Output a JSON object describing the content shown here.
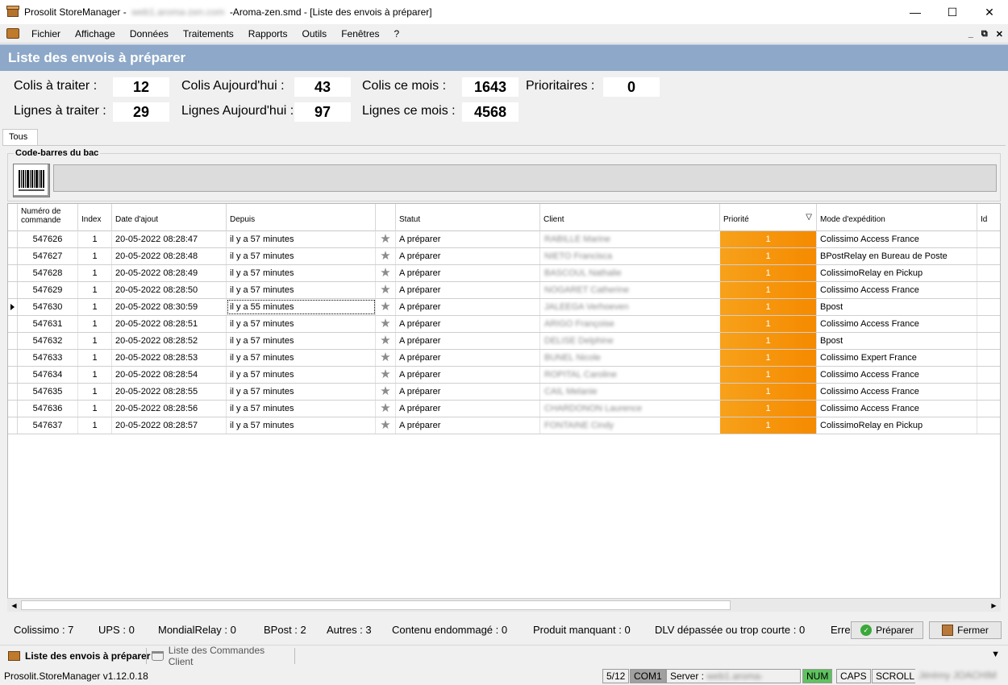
{
  "window": {
    "title_prefix": "Prosolit StoreManager -",
    "title_blurred": "web1.aroma-zen.com",
    "title_suffix": "-Aroma-zen.smd - [Liste des envois à préparer]",
    "minimize": "—",
    "maximize": "☐",
    "close": "✕"
  },
  "menu": {
    "items": [
      "Fichier",
      "Affichage",
      "Données",
      "Traitements",
      "Rapports",
      "Outils",
      "Fenêtres",
      "?"
    ],
    "mdi_min": "_",
    "mdi_restore": "⧉",
    "mdi_close": "✕"
  },
  "header": {
    "title": "Liste des envois à préparer"
  },
  "stats": {
    "colis_a_traiter_label": "Colis à traiter :",
    "colis_a_traiter": "12",
    "colis_aujourdhui_label": "Colis Aujourd'hui :",
    "colis_aujourdhui": "43",
    "colis_ce_mois_label": "Colis ce mois :",
    "colis_ce_mois": "1643",
    "prioritaires_label": "Prioritaires :",
    "prioritaires": "0",
    "lignes_a_traiter_label": "Lignes à traiter :",
    "lignes_a_traiter": "29",
    "lignes_aujourdhui_label": "Lignes Aujourd'hui :",
    "lignes_aujourdhui": "97",
    "lignes_ce_mois_label": "Lignes ce mois :",
    "lignes_ce_mois": "4568"
  },
  "tab": {
    "label": "Tous"
  },
  "barcode": {
    "group_title": "Code-barres du bac",
    "value": ""
  },
  "grid": {
    "headers": {
      "numero": "Numéro de commande",
      "index": "Index",
      "date": "Date d'ajout",
      "depuis": "Depuis",
      "statut": "Statut",
      "client": "Client",
      "priorite": "Priorité",
      "mode": "Mode d'expédition",
      "id": "Id"
    },
    "selected_row": 4,
    "rows": [
      {
        "numero": "547626",
        "index": "1",
        "date": "20-05-2022 08:28:47",
        "depuis": "il y a 57 minutes",
        "statut": "A préparer",
        "client": "RABILLE Marine",
        "priorite": "1",
        "mode": "Colissimo Access France"
      },
      {
        "numero": "547627",
        "index": "1",
        "date": "20-05-2022 08:28:48",
        "depuis": "il y a 57 minutes",
        "statut": "A préparer",
        "client": "NIETO Francisca",
        "priorite": "1",
        "mode": "BPostRelay en Bureau de Poste"
      },
      {
        "numero": "547628",
        "index": "1",
        "date": "20-05-2022 08:28:49",
        "depuis": "il y a 57 minutes",
        "statut": "A préparer",
        "client": "BASCOUL Nathalie",
        "priorite": "1",
        "mode": "ColissimoRelay en Pickup"
      },
      {
        "numero": "547629",
        "index": "1",
        "date": "20-05-2022 08:28:50",
        "depuis": "il y a 57 minutes",
        "statut": "A préparer",
        "client": "NOGARET Catherine",
        "priorite": "1",
        "mode": "Colissimo Access France"
      },
      {
        "numero": "547630",
        "index": "1",
        "date": "20-05-2022 08:30:59",
        "depuis": "il y a 55 minutes",
        "statut": "A préparer",
        "client": "JALEEGA Verhoeven",
        "priorite": "1",
        "mode": "Bpost"
      },
      {
        "numero": "547631",
        "index": "1",
        "date": "20-05-2022 08:28:51",
        "depuis": "il y a 57 minutes",
        "statut": "A préparer",
        "client": "ARIGO Françoise",
        "priorite": "1",
        "mode": "Colissimo Access France"
      },
      {
        "numero": "547632",
        "index": "1",
        "date": "20-05-2022 08:28:52",
        "depuis": "il y a 57 minutes",
        "statut": "A préparer",
        "client": "DELISE Delphine",
        "priorite": "1",
        "mode": "Bpost"
      },
      {
        "numero": "547633",
        "index": "1",
        "date": "20-05-2022 08:28:53",
        "depuis": "il y a 57 minutes",
        "statut": "A préparer",
        "client": "BUNEL Nicole",
        "priorite": "1",
        "mode": "Colissimo Expert France"
      },
      {
        "numero": "547634",
        "index": "1",
        "date": "20-05-2022 08:28:54",
        "depuis": "il y a 57 minutes",
        "statut": "A préparer",
        "client": "ROPITAL Caroline",
        "priorite": "1",
        "mode": "Colissimo Access France"
      },
      {
        "numero": "547635",
        "index": "1",
        "date": "20-05-2022 08:28:55",
        "depuis": "il y a 57 minutes",
        "statut": "A préparer",
        "client": "CAIL Melanie",
        "priorite": "1",
        "mode": "Colissimo Access France"
      },
      {
        "numero": "547636",
        "index": "1",
        "date": "20-05-2022 08:28:56",
        "depuis": "il y a 57 minutes",
        "statut": "A préparer",
        "client": "CHARDONON Laurence",
        "priorite": "1",
        "mode": "Colissimo Access France"
      },
      {
        "numero": "547637",
        "index": "1",
        "date": "20-05-2022 08:28:57",
        "depuis": "il y a 57 minutes",
        "statut": "A préparer",
        "client": "FONTAINE Cindy",
        "priorite": "1",
        "mode": "ColissimoRelay en Pickup"
      }
    ]
  },
  "bottom": {
    "colissimo": "Colissimo : 7",
    "ups": "UPS : 0",
    "mondialrelay": "MondialRelay : 0",
    "bpost": "BPost : 2",
    "autres": "Autres : 3",
    "contenu": "Contenu endommagé : 0",
    "produit": "Produit manquant : 0",
    "dlv": "DLV dépassée ou trop courte : 0",
    "erreur": "Erre",
    "preparer_btn": "Préparer",
    "fermer_btn": "Fermer"
  },
  "doc_tabs": {
    "active": "Liste des envois à préparer",
    "inactive": "Liste des Commandes Client",
    "dropdown": "▼"
  },
  "statusbar": {
    "version": "Prosolit.StoreManager v1.12.0.18",
    "page": "5/12",
    "com": "COM1",
    "server_label": "Server :",
    "server_value": "web1.aroma-zen.com",
    "num": "NUM",
    "caps": "CAPS",
    "scroll": "SCROLL",
    "user": "Jérémy JOACHIM"
  },
  "colors": {
    "header_band": "#8da8c8",
    "priority": "#f58a00",
    "num_active": "#5ec25e"
  }
}
